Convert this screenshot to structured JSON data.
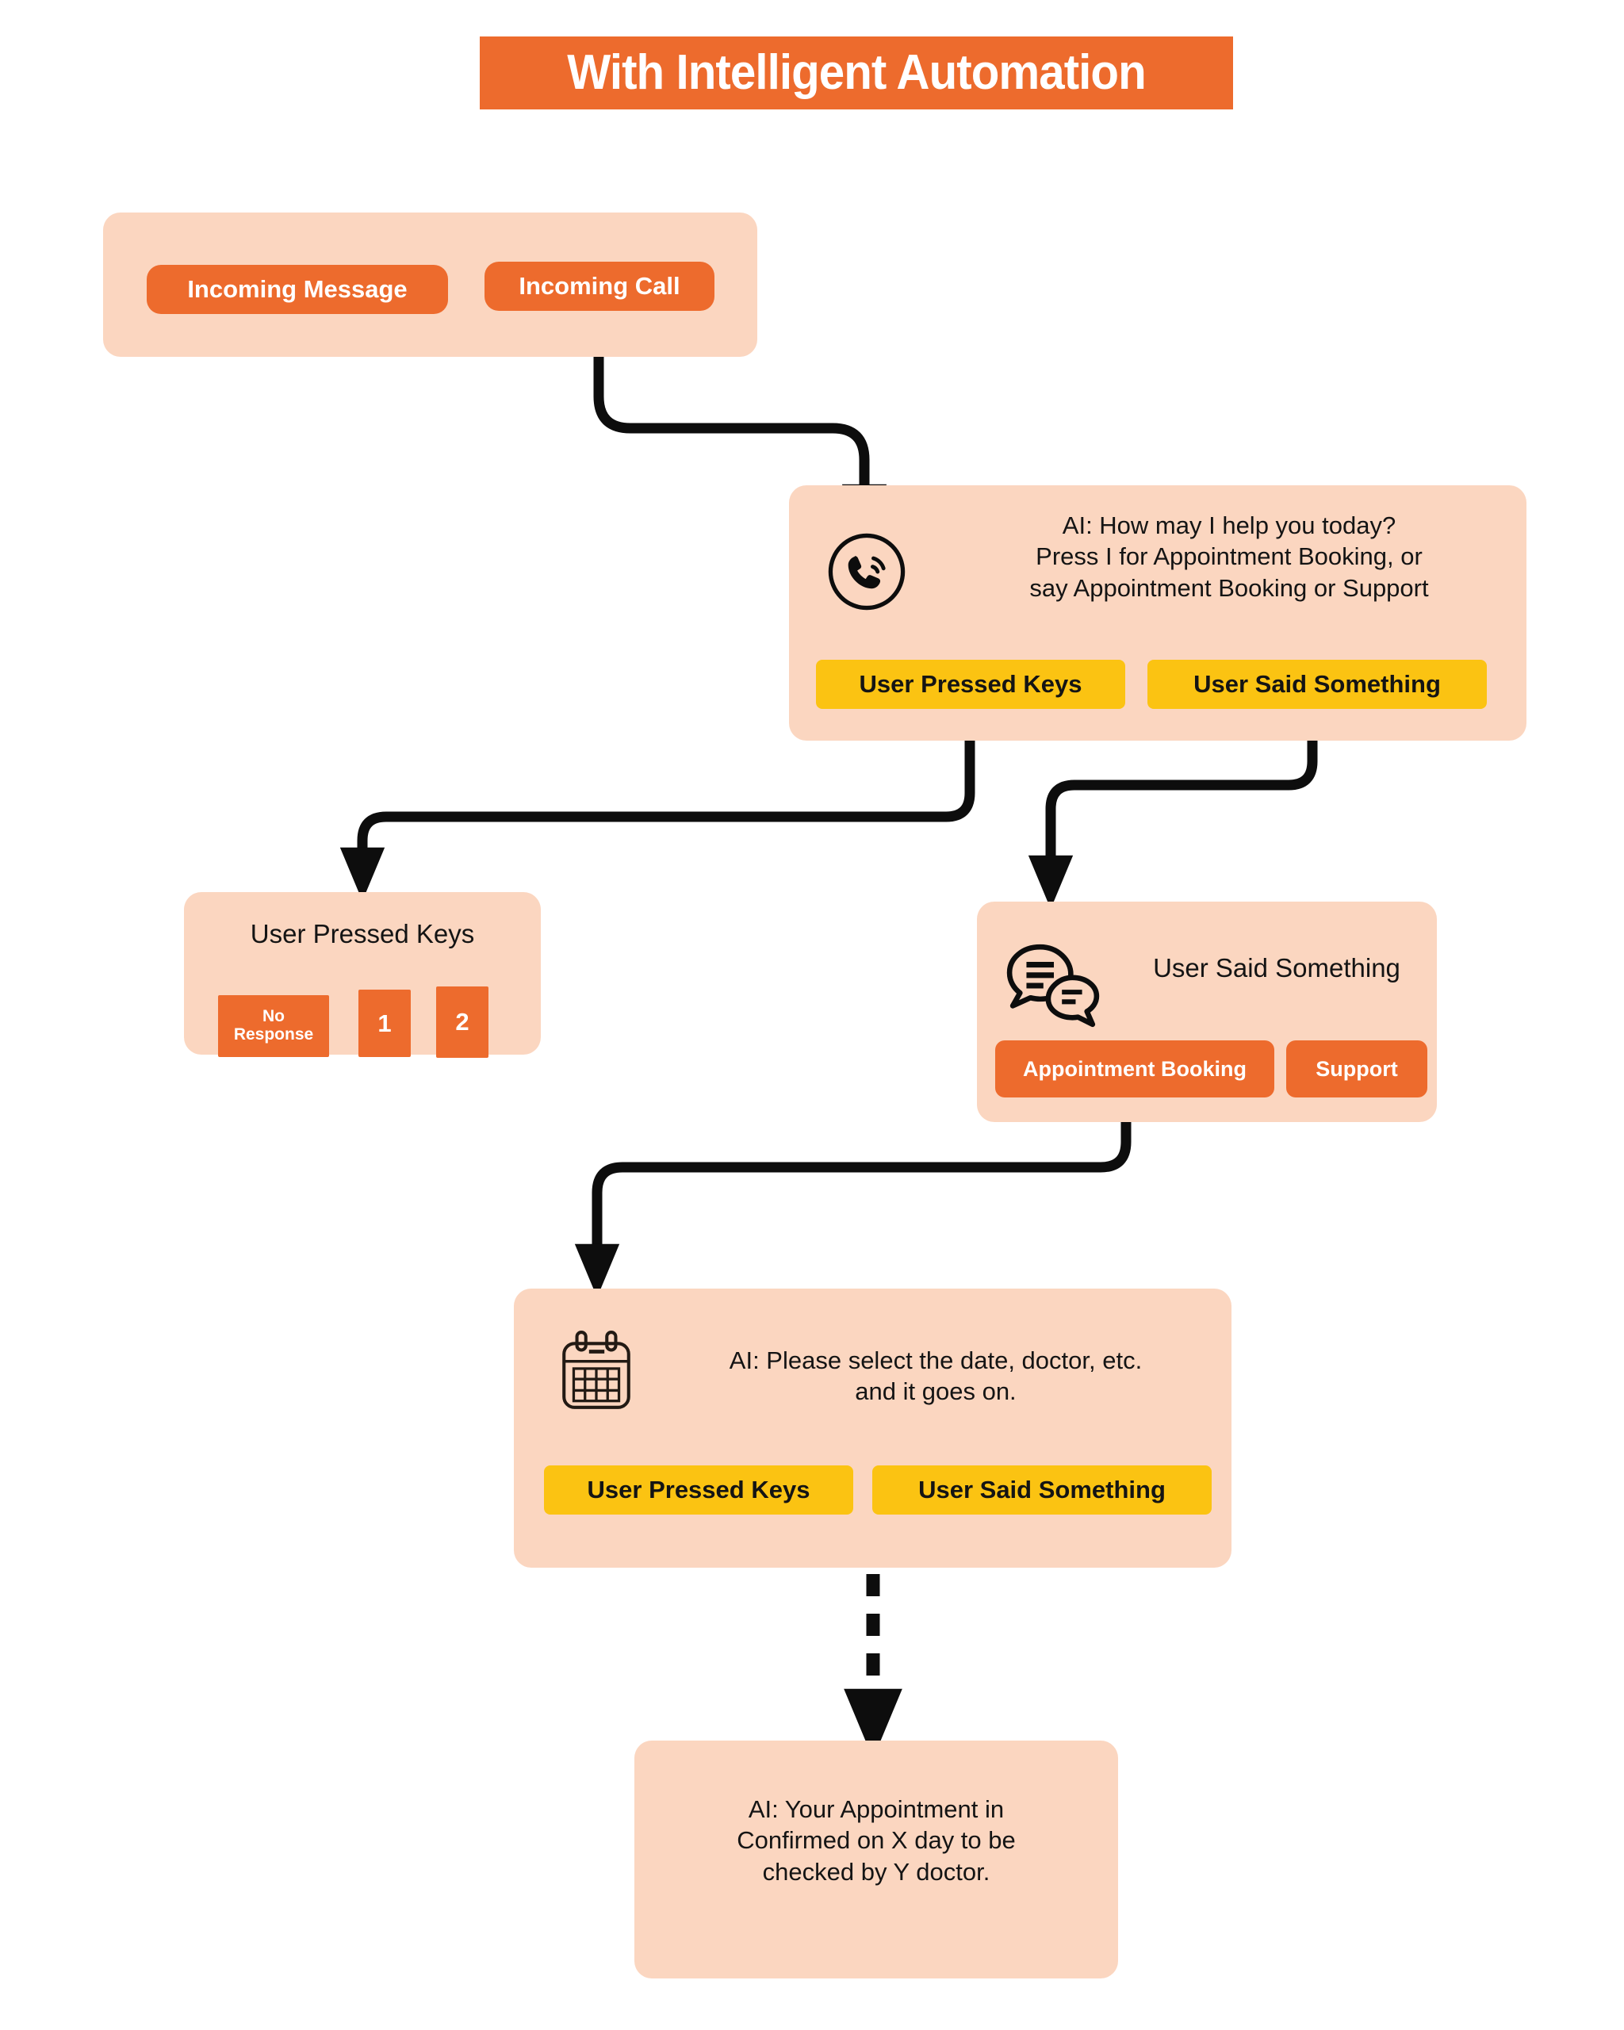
{
  "title": {
    "text": "With Intelligent Automation"
  },
  "colors": {
    "orange": "#ED6B2D",
    "card_peach": "#FBD6C0",
    "yellow": "#FBC312",
    "ink": "#141414",
    "white": "#FFFFFF"
  },
  "nodes": {
    "entry": {
      "pills": [
        {
          "label": "Incoming Message"
        },
        {
          "label": "Incoming Call"
        }
      ]
    },
    "ai_greeting": {
      "icon": "phone-icon",
      "text": "AI: How may I help you today?\nPress I for Appointment Booking, or\nsay Appointment Booking or Support",
      "badges": [
        {
          "label": "User Pressed Keys"
        },
        {
          "label": "User Said Something"
        }
      ]
    },
    "user_pressed_keys": {
      "title": "User Pressed Keys",
      "keys": [
        {
          "label": "No\nResponse"
        },
        {
          "label": "1"
        },
        {
          "label": "2"
        }
      ]
    },
    "user_said_something": {
      "icon": "chat-bubbles-icon",
      "title": "User Said Something",
      "options": [
        {
          "label": "Appointment Booking"
        },
        {
          "label": "Support"
        }
      ]
    },
    "calendar_prompt": {
      "icon": "calendar-icon",
      "text": "AI: Please select the date, doctor, etc.\nand it goes on.",
      "badges": [
        {
          "label": "User Pressed Keys"
        },
        {
          "label": "User Said Something"
        }
      ]
    },
    "confirmation": {
      "text": "AI: Your Appointment in\nConfirmed on X day to be\nchecked by Y doctor."
    }
  },
  "connectors": [
    {
      "name": "incoming-call-to-ai-greeting",
      "style": "solid"
    },
    {
      "name": "pressed-keys-to-keys-node",
      "style": "solid"
    },
    {
      "name": "said-something-to-said-node",
      "style": "solid"
    },
    {
      "name": "appointment-booking-to-calendar",
      "style": "solid"
    },
    {
      "name": "calendar-to-confirmation",
      "style": "dashed"
    }
  ]
}
